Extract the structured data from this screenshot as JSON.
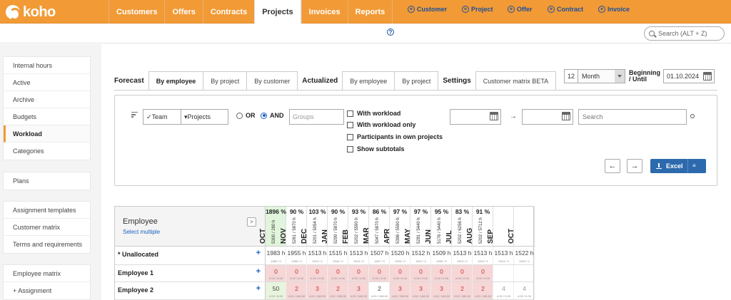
{
  "app": {
    "logo_text": "koho"
  },
  "nav": [
    {
      "label": "Customers",
      "active": false
    },
    {
      "label": "Offers",
      "active": false
    },
    {
      "label": "Contracts",
      "active": false
    },
    {
      "label": "Projects",
      "active": true
    },
    {
      "label": "Invoices",
      "active": false
    },
    {
      "label": "Reports",
      "active": false
    }
  ],
  "quick_actions": {
    "help": "?",
    "customer": "Customer",
    "project": "Project",
    "offer": "Offer",
    "contract": "Contract",
    "invoice": "Invoice",
    "search_placeholder": "Search (ALT + Z)"
  },
  "sidebar": {
    "group1": [
      "Internal hours",
      "Active",
      "Archive",
      "Budgets",
      "Workload",
      "Categories"
    ],
    "group2": [
      "Plans"
    ],
    "group3": [
      "Assignment templates",
      "Customer matrix",
      "Terms and requirements"
    ],
    "group4": [
      "Employee matrix",
      "+ Assignment"
    ],
    "active": "Workload"
  },
  "tabs": {
    "forecast_label": "Forecast",
    "forecast": [
      "By employee",
      "By project",
      "By customer"
    ],
    "actualized_label": "Actualized",
    "actualized": [
      "By employee",
      "By project"
    ],
    "settings_label": "Settings",
    "settings": [
      "Customer matrix BETA"
    ]
  },
  "period": {
    "count": "12",
    "unit": "Month",
    "label_line1": "Beginning",
    "label_line2": "/ Until",
    "date": "01.10.2024"
  },
  "filters": {
    "team": "✓Team",
    "projects": "▾Projects",
    "or_label": "OR",
    "and_label": "AND",
    "groups_placeholder": "Groups",
    "checks": [
      "With workload",
      "With workload only",
      "Participants in own projects",
      "Show subtotals"
    ],
    "search_placeholder": "Search",
    "arrow": "→",
    "excel_label": "Excel",
    "prev": "←",
    "next": "→"
  },
  "grid": {
    "employee_header": "Employee",
    "select_multiple": "Select multiple",
    "collapse": ">",
    "months": [
      {
        "name": "OCT",
        "pct": "1896 %",
        "hours": "5300 / 280 h",
        "current": true
      },
      {
        "name": "NOV",
        "pct": "90 %",
        "hours": "5261 / 5870 h"
      },
      {
        "name": "DEC",
        "pct": "103 %",
        "hours": "5201 / 5054 h"
      },
      {
        "name": "JAN",
        "pct": "90 %",
        "hours": "5299 / 5870 h"
      },
      {
        "name": "FEB",
        "pct": "93 %",
        "hours": "5202 / 5590 h"
      },
      {
        "name": "MAR",
        "pct": "86 %",
        "hours": "5047 / 5870 h"
      },
      {
        "name": "APR",
        "pct": "97 %",
        "hours": "5396 / 5590 h"
      },
      {
        "name": "MAY",
        "pct": "97 %",
        "hours": "5281 / 5440 h"
      },
      {
        "name": "JUN",
        "pct": "95 %",
        "hours": "5176 / 5440 h"
      },
      {
        "name": "JUL",
        "pct": "83 %",
        "hours": "5202 / 6256 h"
      },
      {
        "name": "AUG",
        "pct": "91 %",
        "hours": "5202 / 5712 h"
      },
      {
        "name": "SEP",
        "pct": "",
        "hours": ""
      },
      {
        "name": "OCT",
        "pct": "",
        "hours": ""
      }
    ],
    "rows": [
      {
        "label": "* Unallocated",
        "cells": [
          "1983 h",
          "1955 h",
          "1513 h",
          "1515 h",
          "1513 h",
          "1507 h",
          "1520 h",
          "1512 h",
          "1509 h",
          "1513 h",
          "1513 h",
          "1513 h",
          "1522 h"
        ],
        "sub": [
          "1983 / 0",
          "1955 / 0",
          "1513 / 0",
          "1515 / 0",
          "1513 / 0",
          "1507 / 0",
          "1520 / 0",
          "1512 / 0",
          "1509 / 0",
          "1513 / 0",
          "1513 / 0",
          "1513 / 0",
          "1522 / 0"
        ],
        "style": [
          "plain",
          "plain",
          "plain",
          "plain",
          "plain",
          "plain",
          "plain",
          "plain",
          "plain",
          "plain",
          "plain",
          "plain",
          "plain"
        ]
      },
      {
        "label": "Employee 1",
        "cells": [
          "0",
          "0",
          "0",
          "0",
          "0",
          "0",
          "0",
          "0",
          "0",
          "0",
          "0",
          "",
          ""
        ],
        "sub": [
          "0.00 / 0.00",
          "0.00 / 0.00",
          "0.00 / 0.00",
          "0.00 / 0.00",
          "0.00 / 0.00",
          "0.00 / 0.00",
          "0.00 / 0.00",
          "0.00 / 0.00",
          "0.00 / 0.00",
          "0.00 / 0.00",
          "0.00 / 0.00",
          "",
          ""
        ],
        "style": [
          "red",
          "red",
          "red",
          "red",
          "red",
          "red",
          "red",
          "red",
          "red",
          "red",
          "red",
          "plain",
          "plain"
        ]
      },
      {
        "label": "Employee 2",
        "cells": [
          "50",
          "2",
          "3",
          "2",
          "3",
          "2",
          "3",
          "3",
          "3",
          "2",
          "2",
          "4",
          "4"
        ],
        "sub": [
          "4.00 / 8.00",
          "4.00 / 168.00",
          "4.00 / 168.00",
          "4.00 / 168.00",
          "4.00 / 168.00",
          "4.00 / 168.00",
          "4.00 / 168.00",
          "4.00 / 168.00",
          "4.00 / 168.00",
          "4.00 / 168.00",
          "4.00 / 168.00",
          "4.00 / 0.00",
          "4.00 / 0.00"
        ],
        "style": [
          "green",
          "red",
          "red",
          "red",
          "red",
          "plain",
          "red",
          "red",
          "red",
          "red",
          "red",
          "gray",
          "gray"
        ]
      }
    ]
  }
}
